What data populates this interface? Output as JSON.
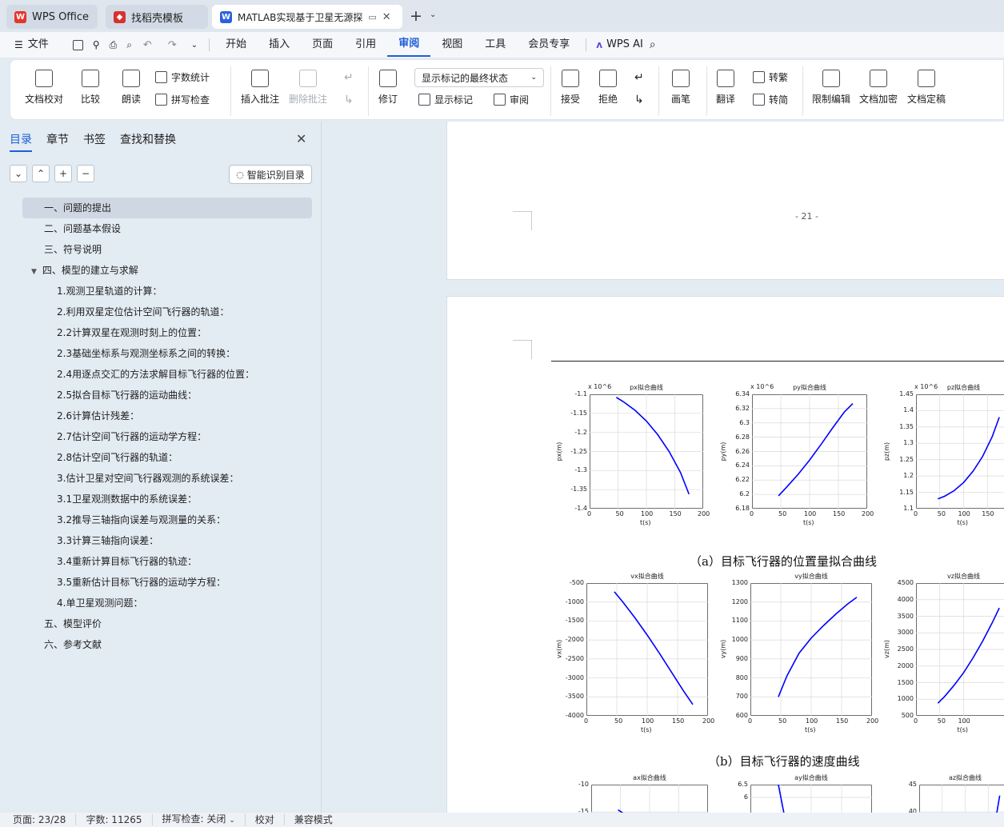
{
  "tabs": [
    {
      "label": "WPS Office",
      "icon": "wps-logo-icon",
      "color": "#e5352c"
    },
    {
      "label": "找稻壳模板",
      "icon": "docer-icon",
      "color": "#d8312e"
    },
    {
      "label": "MATLAB实现基于卫星无源探",
      "icon": "word-doc-icon",
      "color": "#2b62d9"
    }
  ],
  "menu": {
    "file": "文件",
    "items": [
      "开始",
      "插入",
      "页面",
      "引用",
      "审阅",
      "视图",
      "工具",
      "会员专享"
    ],
    "selected": "审阅",
    "ai": "WPS AI"
  },
  "ribbon": {
    "doc_check": "文档校对",
    "compare": "比较",
    "read_aloud": "朗读",
    "word_count": "字数统计",
    "spell_check": "拼写检查",
    "insert_comment": "插入批注",
    "delete_comment": "删除批注",
    "track": "修订",
    "markup_state": "显示标记的最终状态",
    "show_markup": "显示标记",
    "review": "审阅",
    "accept": "接受",
    "reject": "拒绝",
    "pen": "画笔",
    "translate": "翻译",
    "to_traditional": "转繁",
    "to_simplified": "转简",
    "restrict": "限制编辑",
    "encrypt": "文档加密",
    "finalize": "文档定稿"
  },
  "sidebar": {
    "tabs": [
      "目录",
      "章节",
      "书签",
      "查找和替换"
    ],
    "smart_toc": "智能识别目录",
    "toc": [
      {
        "label": "一、问题的提出",
        "level": 1,
        "highlight": true
      },
      {
        "label": "二、问题基本假设",
        "level": 1
      },
      {
        "label": "三、符号说明",
        "level": 1
      },
      {
        "label": "四、模型的建立与求解",
        "level": 1,
        "expanded": true
      },
      {
        "label": "1.观测卫星轨道的计算：",
        "level": 2
      },
      {
        "label": "2.利用双星定位估计空间飞行器的轨道：",
        "level": 2
      },
      {
        "label": "2.2计算双星在观测时刻上的位置：",
        "level": 2
      },
      {
        "label": "2.3基础坐标系与观测坐标系之间的转换：",
        "level": 2
      },
      {
        "label": "2.4用逐点交汇的方法求解目标飞行器的位置：",
        "level": 2
      },
      {
        "label": "2.5拟合目标飞行器的运动曲线：",
        "level": 2
      },
      {
        "label": "2.6计算估计残差：",
        "level": 2
      },
      {
        "label": "2.7估计空间飞行器的运动学方程：",
        "level": 2
      },
      {
        "label": "2.8估计空间飞行器的轨道：",
        "level": 2
      },
      {
        "label": "3.估计卫星对空间飞行器观测的系统误差：",
        "level": 2
      },
      {
        "label": "3.1卫星观测数据中的系统误差：",
        "level": 2
      },
      {
        "label": "3.2推导三轴指向误差与观测量的关系：",
        "level": 2
      },
      {
        "label": "3.3计算三轴指向误差：",
        "level": 2
      },
      {
        "label": "3.4重新计算目标飞行器的轨迹：",
        "level": 2
      },
      {
        "label": "3.5重新估计目标飞行器的运动学方程：",
        "level": 2
      },
      {
        "label": "4.单卫星观测问题：",
        "level": 2
      },
      {
        "label": "五、模型评价",
        "level": 1
      },
      {
        "label": "六、参考文献",
        "level": 1
      }
    ]
  },
  "document": {
    "page_number": "- 21 -",
    "caption_a": "（a）目标飞行器的位置量拟合曲线",
    "caption_b": "（b）目标飞行器的速度曲线"
  },
  "chart_data": [
    {
      "type": "line",
      "title": "px拟合曲线",
      "xlabel": "t(s)",
      "ylabel": "px(m)",
      "multiplier": "x 10^6",
      "xlim": [
        0,
        200
      ],
      "ylim": [
        -1.4,
        -1.1
      ],
      "xticks": [
        0,
        50,
        100,
        150,
        200
      ],
      "yticks": [
        -1.1,
        -1.15,
        -1.2,
        -1.25,
        -1.3,
        -1.35,
        -1.4
      ],
      "ytick_labels": [
        "-1.1",
        "-1.15",
        "-1.2",
        "-1.25",
        "-1.3",
        "-1.35",
        "-1.4"
      ],
      "series": [
        {
          "color": "#0000ff",
          "x": [
            47,
            60,
            80,
            100,
            120,
            140,
            160,
            175
          ],
          "y": [
            -1.108,
            -1.12,
            -1.142,
            -1.17,
            -1.206,
            -1.25,
            -1.305,
            -1.362
          ]
        }
      ]
    },
    {
      "type": "line",
      "title": "py拟合曲线",
      "xlabel": "t(s)",
      "ylabel": "py(m)",
      "multiplier": "x 10^6",
      "xlim": [
        0,
        200
      ],
      "ylim": [
        6.18,
        6.34
      ],
      "xticks": [
        0,
        50,
        100,
        150,
        200
      ],
      "yticks": [
        6.34,
        6.32,
        6.3,
        6.28,
        6.26,
        6.24,
        6.22,
        6.2,
        6.18
      ],
      "ytick_labels": [
        "6.34",
        "6.32",
        "6.3",
        "6.28",
        "6.26",
        "6.24",
        "6.22",
        "6.2",
        "6.18"
      ],
      "series": [
        {
          "color": "#0000ff",
          "x": [
            46,
            60,
            80,
            100,
            120,
            140,
            160,
            175
          ],
          "y": [
            6.198,
            6.21,
            6.228,
            6.248,
            6.27,
            6.293,
            6.315,
            6.327
          ]
        }
      ]
    },
    {
      "type": "line",
      "title": "pz拟合曲线",
      "xlabel": "t(s)",
      "ylabel": "pz(m)",
      "multiplier": "x 10^6",
      "xlim": [
        0,
        200
      ],
      "ylim": [
        1.1,
        1.45
      ],
      "xticks": [
        0,
        50,
        100,
        150
      ],
      "yticks": [
        1.45,
        1.4,
        1.35,
        1.3,
        1.25,
        1.2,
        1.15,
        1.1
      ],
      "ytick_labels": [
        "1.45",
        "1.4",
        "1.35",
        "1.3",
        "1.25",
        "1.2",
        "1.15",
        "1.1"
      ],
      "series": [
        {
          "color": "#0000ff",
          "x": [
            46,
            60,
            80,
            100,
            120,
            140,
            160,
            175
          ],
          "y": [
            1.13,
            1.138,
            1.155,
            1.18,
            1.215,
            1.26,
            1.32,
            1.38
          ]
        }
      ]
    },
    {
      "type": "line",
      "title": "vx拟合曲线",
      "xlabel": "t(s)",
      "ylabel": "vx(m)",
      "xlim": [
        0,
        200
      ],
      "ylim": [
        -4000,
        -500
      ],
      "xticks": [
        0,
        50,
        100,
        150,
        200
      ],
      "yticks": [
        -500,
        -1000,
        -1500,
        -2000,
        -2500,
        -3000,
        -3500,
        -4000
      ],
      "ytick_labels": [
        "-500",
        "-1000",
        "-1500",
        "-2000",
        "-2500",
        "-3000",
        "-3500",
        "-4000"
      ],
      "series": [
        {
          "color": "#0000ff",
          "x": [
            46,
            60,
            80,
            100,
            120,
            140,
            160,
            175
          ],
          "y": [
            -730,
            -1000,
            -1420,
            -1870,
            -2350,
            -2850,
            -3350,
            -3700
          ]
        }
      ]
    },
    {
      "type": "line",
      "title": "vy拟合曲线",
      "xlabel": "t(s)",
      "ylabel": "vy(m)",
      "xlim": [
        0,
        200
      ],
      "ylim": [
        600,
        1300
      ],
      "xticks": [
        0,
        50,
        100,
        150,
        200
      ],
      "yticks": [
        1300,
        1200,
        1100,
        1000,
        900,
        800,
        700,
        600
      ],
      "ytick_labels": [
        "1300",
        "1200",
        "1100",
        "1000",
        "900",
        "800",
        "700",
        "600"
      ],
      "series": [
        {
          "color": "#0000ff",
          "x": [
            46,
            60,
            80,
            100,
            120,
            140,
            160,
            175
          ],
          "y": [
            700,
            810,
            930,
            1010,
            1075,
            1135,
            1190,
            1225
          ]
        }
      ]
    },
    {
      "type": "line",
      "title": "vz拟合曲线",
      "xlabel": "t(s)",
      "ylabel": "vz(m)",
      "xlim": [
        0,
        200
      ],
      "ylim": [
        500,
        4500
      ],
      "xticks": [
        0,
        50,
        100
      ],
      "yticks": [
        4500,
        4000,
        3500,
        3000,
        2500,
        2000,
        1500,
        1000,
        500
      ],
      "ytick_labels": [
        "4500",
        "4000",
        "3500",
        "3000",
        "2500",
        "2000",
        "1500",
        "1000",
        "500"
      ],
      "series": [
        {
          "color": "#0000ff",
          "x": [
            46,
            60,
            80,
            100,
            120,
            140,
            160,
            175
          ],
          "y": [
            880,
            1080,
            1420,
            1800,
            2250,
            2750,
            3300,
            3750
          ]
        }
      ]
    },
    {
      "type": "line",
      "title": "ax拟合曲线",
      "ylim": [
        -17,
        -10
      ],
      "yticks": [
        -10,
        -15
      ],
      "ytick_labels": [
        "-10",
        "-15"
      ],
      "series": [
        {
          "color": "#0000ff",
          "x": [
            46,
            60
          ],
          "y": [
            -14.6,
            -15.6
          ]
        }
      ]
    },
    {
      "type": "line",
      "title": "ay拟合曲线",
      "ylim": [
        5,
        6.5
      ],
      "yticks": [
        6.5,
        6
      ],
      "ytick_labels": [
        "6.5",
        "6"
      ],
      "series": [
        {
          "color": "#0000ff",
          "x": [
            46,
            55
          ],
          "y": [
            6.5,
            5.4
          ]
        }
      ]
    },
    {
      "type": "line",
      "title": "az拟合曲线",
      "ylim": [
        38,
        45
      ],
      "yticks": [
        45,
        40
      ],
      "ytick_labels": [
        "45",
        "40"
      ],
      "series": [
        {
          "color": "#0000ff",
          "x": [
            165,
            175
          ],
          "y": [
            38,
            43
          ]
        }
      ]
    }
  ],
  "status": {
    "page": "页面: 23/28",
    "words": "字数: 11265",
    "spell": "拼写检查: 关闭",
    "proof": "校对",
    "compat": "兼容模式"
  }
}
